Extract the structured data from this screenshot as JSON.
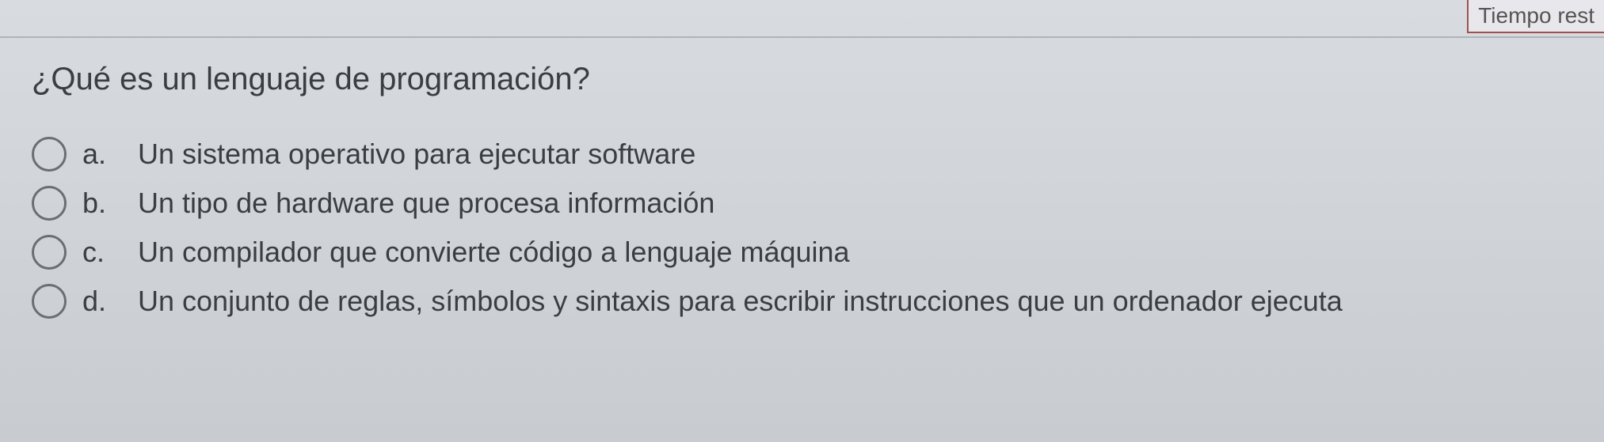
{
  "timer": {
    "label": "Tiempo rest"
  },
  "question": {
    "text": "¿Qué es un lenguaje de programación?"
  },
  "options": [
    {
      "letter": "a.",
      "text": "Un sistema operativo para ejecutar software"
    },
    {
      "letter": "b.",
      "text": "Un tipo de hardware que procesa información"
    },
    {
      "letter": "c.",
      "text": "Un compilador que convierte código a lenguaje máquina"
    },
    {
      "letter": "d.",
      "text": "Un conjunto de reglas, símbolos y sintaxis para escribir instrucciones que un ordenador ejecuta"
    }
  ]
}
